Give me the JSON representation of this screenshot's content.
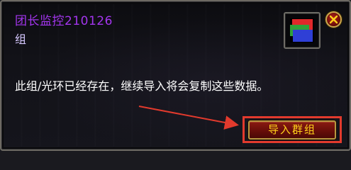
{
  "dialog": {
    "title": "团长监控210126",
    "title_suffix": "组",
    "message": "此组/光环已经存在，继续导入将会复制这些数据。",
    "import_button_label": "导入群组",
    "icon": "aura-group-icon",
    "close_icon": "close-icon"
  },
  "colors": {
    "title": "#a335ee",
    "button_text": "#ffd21a",
    "highlight_box": "#e23a2d",
    "icon_red": "#e0282a",
    "icon_green": "#2fa23a",
    "icon_blue": "#2f3fd6"
  }
}
